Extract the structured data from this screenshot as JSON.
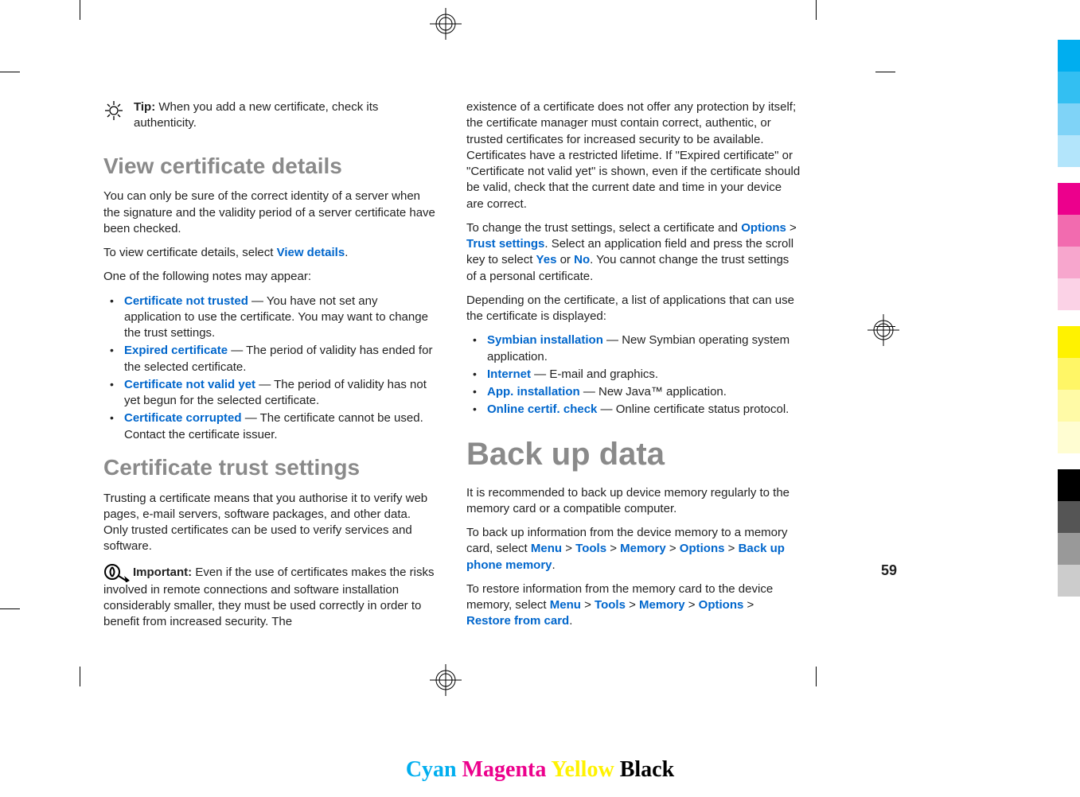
{
  "page_number": "59",
  "tip": {
    "label": "Tip:",
    "text": " When you add a new certificate, check its authenticity."
  },
  "s1": {
    "heading": "View certificate details",
    "p1": "You can only be sure of the correct identity of a server when the signature and the validity period of a server certificate have been checked.",
    "p2a": "To view certificate details, select ",
    "p2b": "View details",
    "p2c": ".",
    "p3": "One of the following notes may appear:",
    "items": [
      {
        "term": "Certificate not trusted",
        "desc": " — You have not set any application to use the certificate. You may want to change the trust settings."
      },
      {
        "term": "Expired certificate",
        "desc": " — The period of validity has ended for the selected certificate."
      },
      {
        "term": "Certificate not valid yet",
        "desc": " — The period of validity has not yet begun for the selected certificate."
      },
      {
        "term": "Certificate corrupted",
        "desc": " — The certificate cannot be used. Contact the certificate issuer."
      }
    ]
  },
  "s2": {
    "heading": "Certificate trust settings",
    "p1": "Trusting a certificate means that you authorise it to verify web pages, e-mail servers, software packages, and other data. Only trusted certificates can be used to verify services and software.",
    "imp_label": "Important:",
    "imp_text": " Even if the use of certificates makes the risks involved in remote connections and software installation considerably smaller, they must be used correctly in order to benefit from increased security. The ",
    "cont1": "existence of a certificate does not offer any protection by itself; the certificate manager must contain correct, authentic, or trusted certificates for increased security to be available. Certificates have a restricted lifetime. If \"Expired certificate\" or \"Certificate not valid yet\" is shown, even if the certificate should be valid, check that the current date and time in your device are correct.",
    "p2a": "To change the trust settings, select a certificate and ",
    "nav1a": "Options",
    "nav1b": "Trust settings",
    "p2b": ". Select an application field and press the scroll key to select ",
    "yes": "Yes",
    "or": " or ",
    "no": "No",
    "p2c": ". You cannot change the trust settings of a personal certificate.",
    "p3": "Depending on the certificate, a list of applications that can use the certificate is displayed:",
    "items": [
      {
        "term": "Symbian installation",
        "desc": " — New Symbian operating system application."
      },
      {
        "term": "Internet",
        "desc": " — E-mail and graphics."
      },
      {
        "term": "App. installation",
        "desc": " — New Java™ application."
      },
      {
        "term": "Online certif. check",
        "desc": " — Online certificate status protocol."
      }
    ]
  },
  "s3": {
    "heading": "Back up data",
    "p1": "It is recommended to back up device memory regularly to the memory card or a compatible computer.",
    "p2a": "To back up information from the device memory to a memory card, select ",
    "nav2": {
      "a": "Menu",
      "b": "Tools",
      "c": "Memory",
      "d": "Options",
      "e": "Back up phone memory"
    },
    "p3a": "To restore information from the memory card to the device memory, select ",
    "nav3": {
      "a": "Menu",
      "b": "Tools",
      "c": "Memory",
      "d": "Options",
      "e": "Restore from card"
    }
  },
  "cmyk": {
    "c": "Cyan",
    "m": "Magenta",
    "y": "Yellow",
    "k": "Black"
  },
  "gt": " > ",
  "dot": "."
}
